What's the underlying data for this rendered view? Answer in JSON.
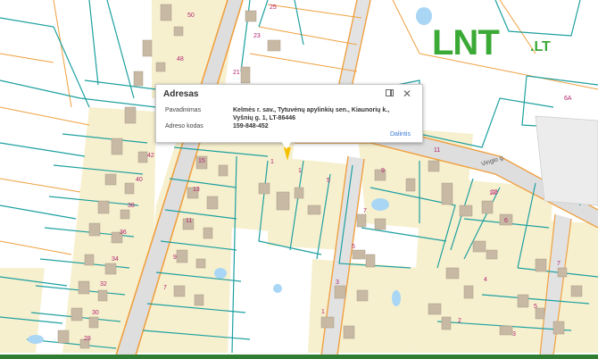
{
  "logo": {
    "text": "LNT",
    "tld": ".LT"
  },
  "popup": {
    "title": "Adresas",
    "fields": [
      {
        "label": "Pavadinimas",
        "value_line1": "Kelmės r. sav., Tytuvėnų apylinkių sen., Kiaunorių k.,",
        "value_line2": "Vyšnių g. 1, LT-86446"
      },
      {
        "label": "Adreso kodas",
        "value": "159-848-452"
      }
    ],
    "share_label": "Dalintis",
    "dock_icon": "dock-panel-icon",
    "close_icon": "close-icon"
  },
  "map": {
    "street_label": "Vingio g.",
    "colors": {
      "parcel_fill": "#f7f0cf",
      "parcel_border": "#1fa0a0",
      "road_edge": "#f0a040",
      "road": "#d7d7d7",
      "water": "#a9d6f5",
      "building": "#c8b9a4"
    },
    "house_numbers": [
      "50",
      "25",
      "48",
      "23",
      "21",
      "42",
      "15",
      "1",
      "1",
      "5",
      "9",
      "11",
      "13",
      "6A",
      "40",
      "13",
      "7",
      "13",
      "6",
      "38",
      "11",
      "5",
      "36",
      "34",
      "9",
      "3",
      "4",
      "32",
      "7",
      "30",
      "28",
      "1",
      "3",
      "2",
      "5",
      "7"
    ]
  }
}
